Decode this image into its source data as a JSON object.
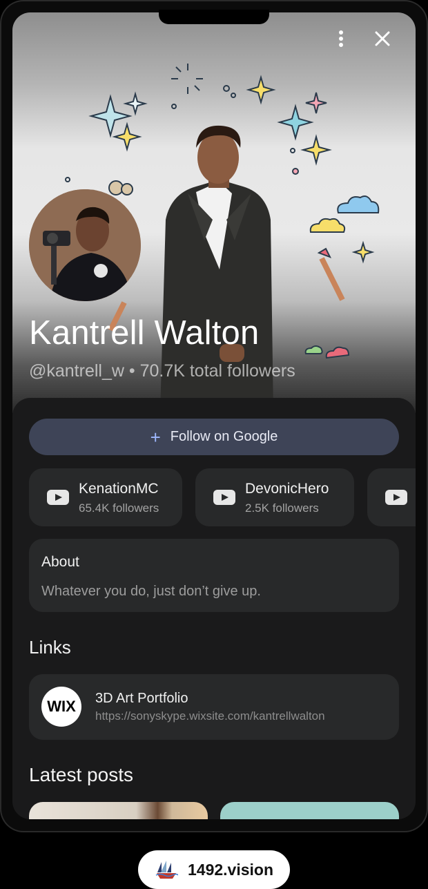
{
  "profile": {
    "name": "Kantrell Walton",
    "subtitle": "@kantrell_w • 70.7K total followers"
  },
  "actions": {
    "follow_label": "Follow on Google",
    "menu_icon": "more-vert-icon",
    "close_icon": "close-icon"
  },
  "channels": [
    {
      "name": "KenationMC",
      "followers": "65.4K followers",
      "icon": "youtube-icon"
    },
    {
      "name": "DevonicHero",
      "followers": "2.5K followers",
      "icon": "youtube-icon"
    },
    {
      "name": "",
      "followers": "",
      "icon": "youtube-icon"
    }
  ],
  "about": {
    "heading": "About",
    "text": "Whatever you do, just don’t give up."
  },
  "links": {
    "heading": "Links",
    "items": [
      {
        "logo_text": "WIX",
        "title": "3D Art Portfolio",
        "url": "https://sonyskype.wixsite.com/kantrellwalton"
      }
    ]
  },
  "posts": {
    "heading": "Latest posts"
  },
  "watermark": {
    "text": "1492.vision"
  },
  "colors": {
    "follow_button_bg": "#3e4457",
    "card_bg": "#28292a",
    "panel_bg": "#1a1a1b",
    "accent_plus": "#9fb8ff"
  }
}
